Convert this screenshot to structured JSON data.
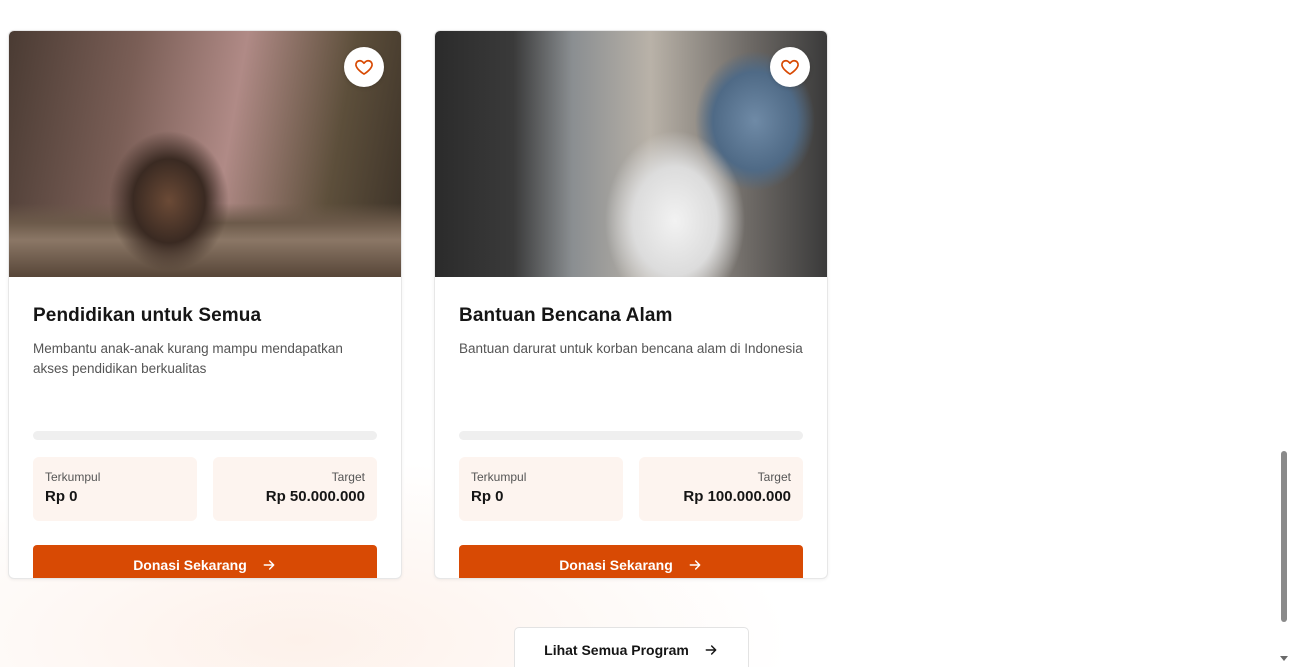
{
  "programs": [
    {
      "title": "Pendidikan untuk Semua",
      "description": "Membantu anak-anak kurang mampu mendapatkan akses pendidikan berkualitas",
      "progress": 0,
      "collected_label": "Terkumpul",
      "collected_value": "Rp 0",
      "target_label": "Target",
      "target_value": "Rp 50.000.000",
      "button_label": "Donasi Sekarang",
      "image_icon": "child-photo",
      "favorite_icon": "heart-icon"
    },
    {
      "title": "Bantuan Bencana Alam",
      "description": "Bantuan darurat untuk korban bencana alam di Indonesia",
      "progress": 0,
      "collected_label": "Terkumpul",
      "collected_value": "Rp 0",
      "target_label": "Target",
      "target_value": "Rp 100.000.000",
      "button_label": "Donasi Sekarang",
      "image_icon": "volunteers-photo",
      "favorite_icon": "heart-icon"
    }
  ],
  "view_all": {
    "label": "Lihat Semua Program",
    "icon": "arrow-right-icon"
  },
  "colors": {
    "accent": "#d84a04",
    "stat_bg": "#fdf4ef",
    "heart": "#d84a04"
  }
}
